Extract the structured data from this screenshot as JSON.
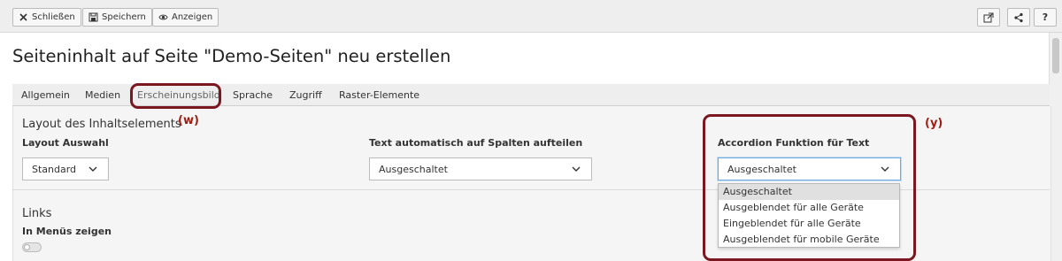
{
  "toolbar": {
    "close_label": "Schließen",
    "save_label": "Speichern",
    "view_label": "Anzeigen",
    "help_label": "?"
  },
  "page": {
    "title": "Seiteninhalt auf Seite \"Demo-Seiten\" neu erstellen"
  },
  "tabs": [
    {
      "label": "Allgemein"
    },
    {
      "label": "Medien"
    },
    {
      "label": "Erscheinungsbild",
      "active": true
    },
    {
      "label": "Sprache"
    },
    {
      "label": "Zugriff"
    },
    {
      "label": "Raster-Elemente"
    }
  ],
  "layout_section": {
    "title": "Layout des Inhaltselements",
    "layout_select": {
      "label": "Layout Auswahl",
      "value": "Standard"
    },
    "columns_select": {
      "label": "Text automatisch auf Spalten aufteilen",
      "value": "Ausgeschaltet"
    },
    "accordion_select": {
      "label": "Accordion Funktion für Text",
      "value": "Ausgeschaltet",
      "options": [
        "Ausgeschaltet",
        "Ausgeblendet für alle Geräte",
        "Eingeblendet für alle Geräte",
        "Ausgeblendet für mobile Geräte"
      ]
    }
  },
  "links_section": {
    "title": "Links",
    "menu_toggle_label": "In Menüs zeigen",
    "menu_toggle_on": false
  },
  "annotations": {
    "w": "(w)",
    "y": "(y)",
    "color": "#7a1720"
  },
  "colors": {
    "toolbar_bg": "#eeeeee",
    "focus_border": "#6daae0",
    "annotation_red": "#7a1720"
  },
  "icons": [
    "close-icon",
    "save-icon",
    "eye-icon",
    "external-link-icon",
    "share-icon",
    "help-icon",
    "chevron-down-icon"
  ]
}
